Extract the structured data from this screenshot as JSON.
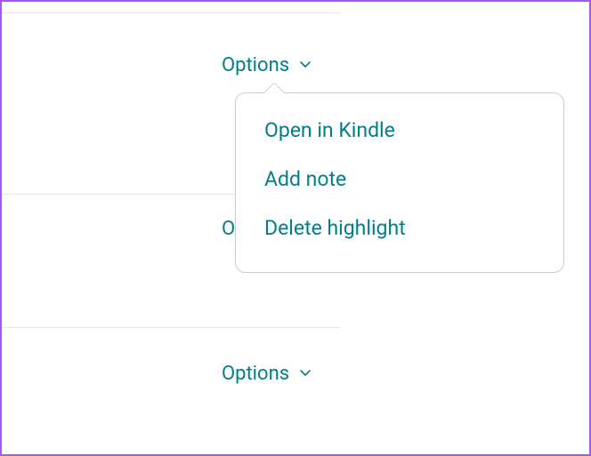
{
  "triggers": {
    "first": {
      "label": "Options"
    },
    "second": {
      "label": "Options"
    }
  },
  "peek_char": "O",
  "dropdown": {
    "items": [
      {
        "label": "Open in Kindle"
      },
      {
        "label": "Add note"
      },
      {
        "label": "Delete highlight"
      }
    ]
  }
}
